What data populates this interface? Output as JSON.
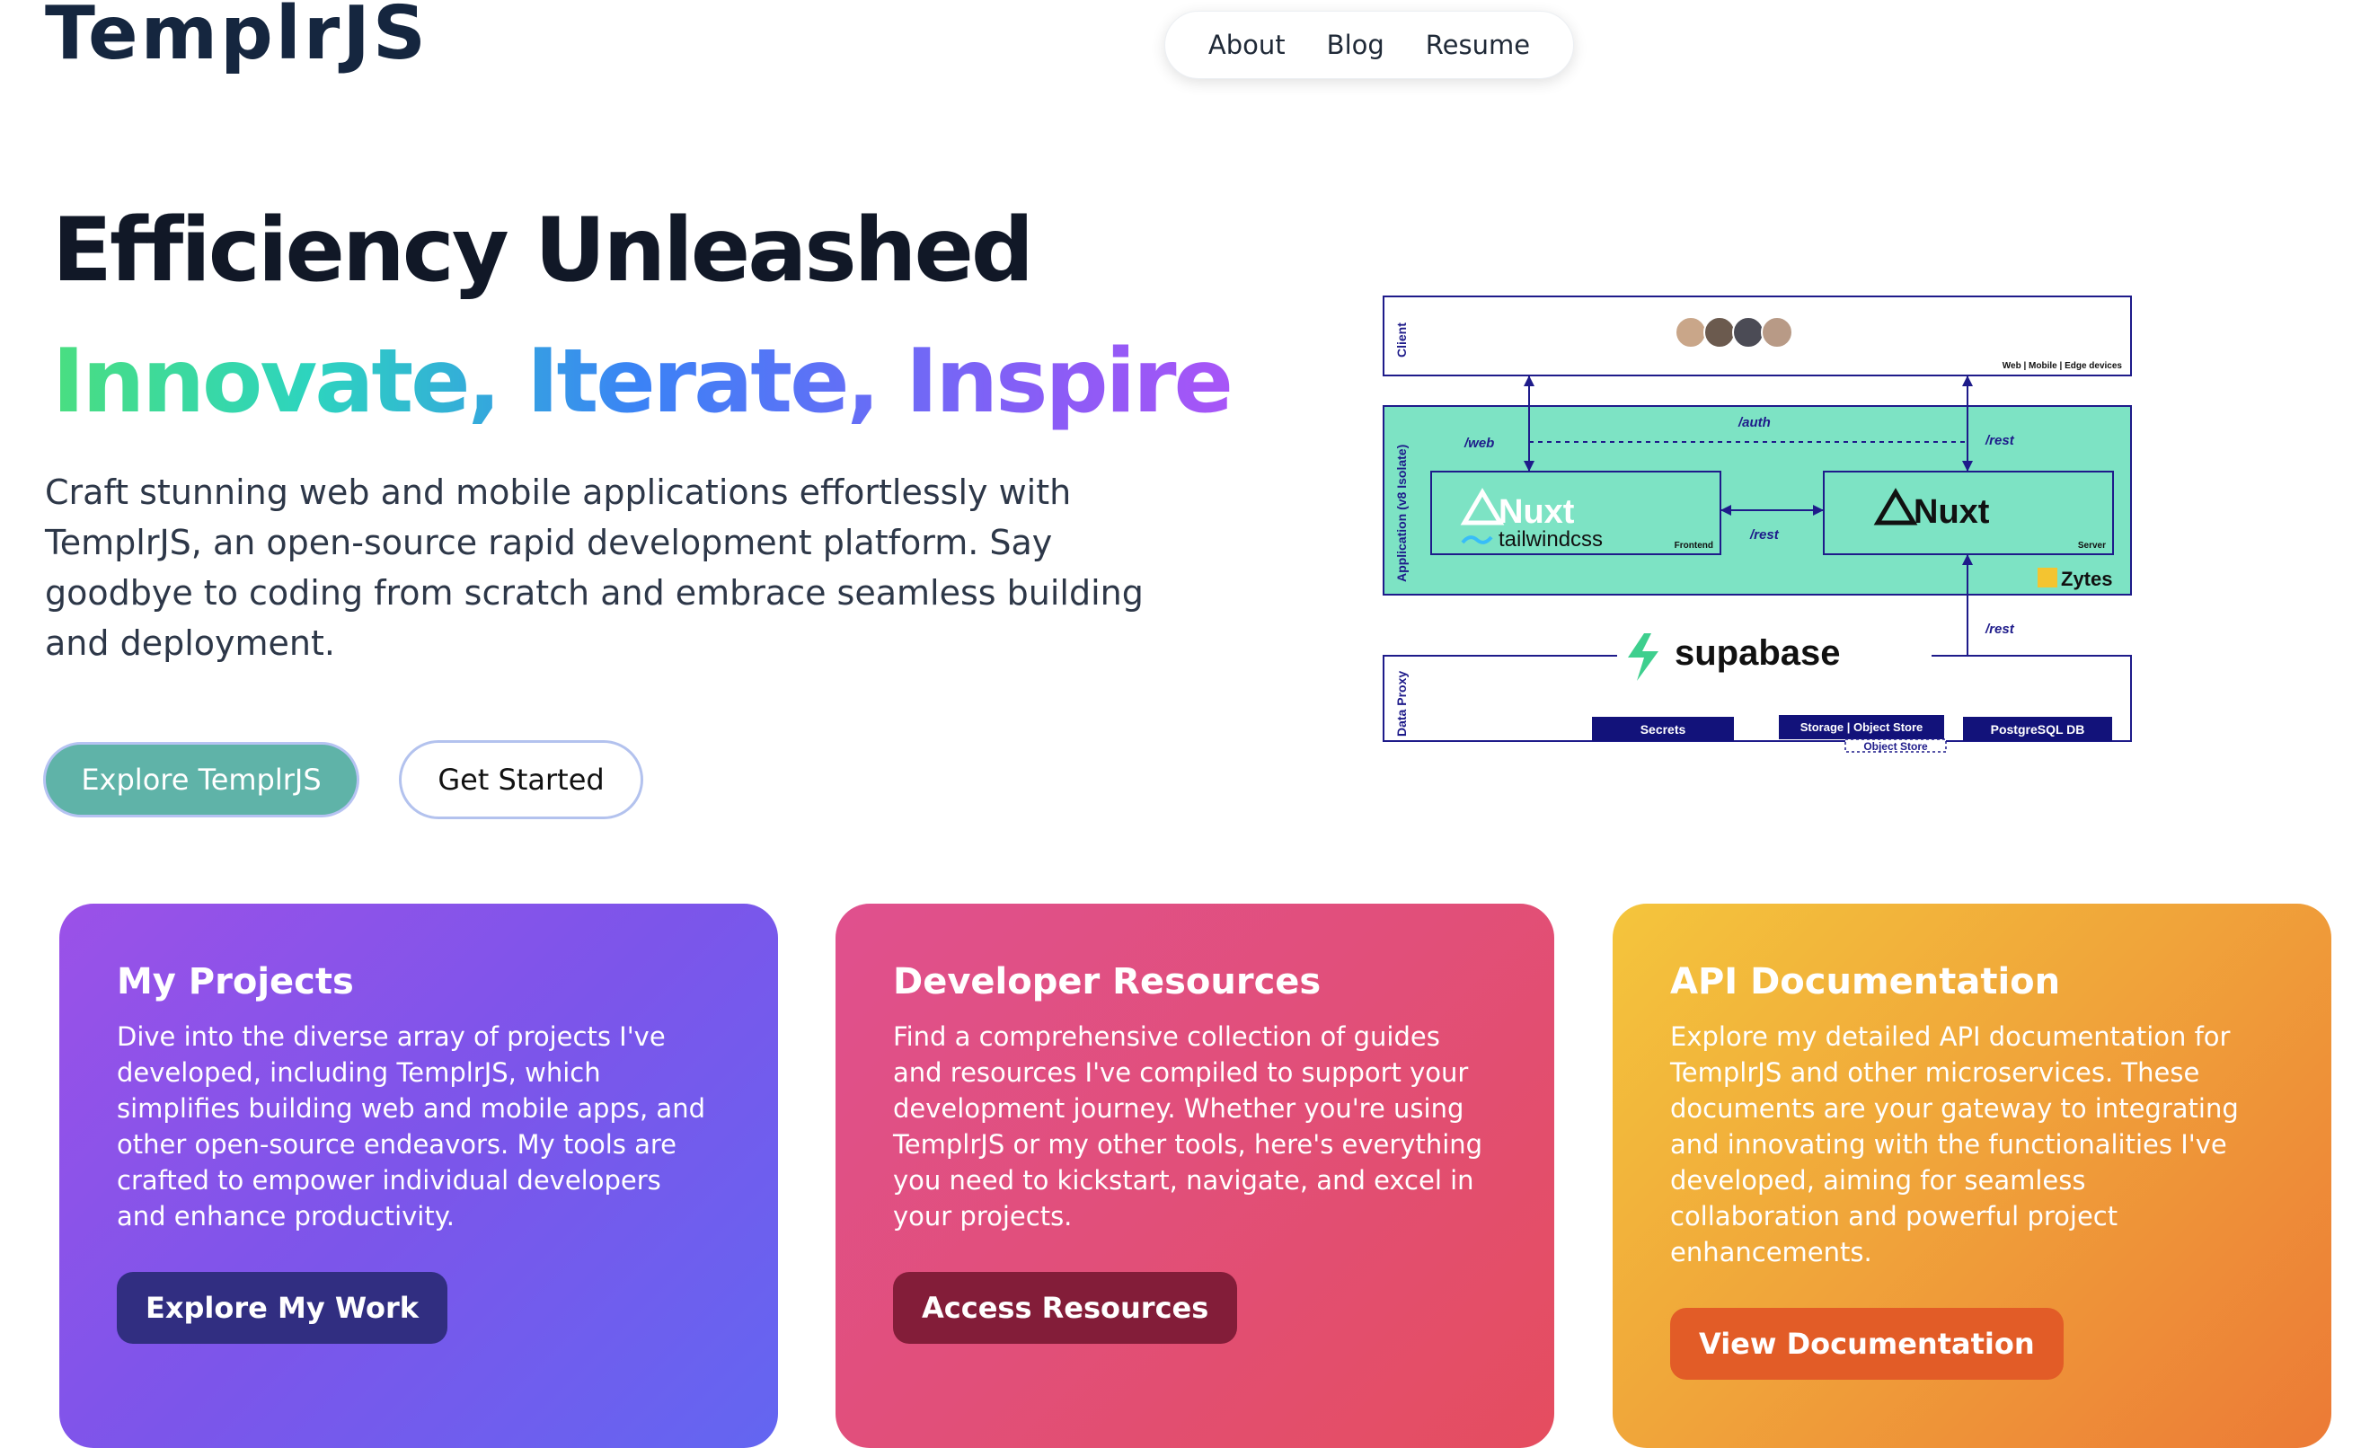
{
  "header": {
    "logo": "TemplrJS",
    "nav": [
      "About",
      "Blog",
      "Resume"
    ]
  },
  "hero": {
    "title": "Efficiency Unleashed",
    "subtitle": "Innovate, Iterate, Inspire",
    "description": "Craft stunning web and mobile applications effortlessly with TemplrJS, an open-source rapid development platform. Say goodbye to coding from scratch and embrace seamless building and deployment.",
    "primary_button": "Explore TemplrJS",
    "secondary_button": "Get Started"
  },
  "diagram": {
    "client_label": "Client",
    "devices": "Web | Mobile | Edge devices",
    "app_label": "Application (v8 Isolate)",
    "web_route": "/web",
    "auth_route": "/auth",
    "rest_route": "/rest",
    "rest_route_mid": "/rest",
    "rest_route_low": "/rest",
    "frontend_brand": "Nuxt",
    "frontend_css": "tailwindcss",
    "frontend_label": "Frontend",
    "server_brand": "Nuxt",
    "server_label": "Server",
    "zytes": "Zytes",
    "supabase": "supabase",
    "data_label": "Data Proxy",
    "secrets": "Secrets",
    "storage": "Storage | Object Store",
    "object_store": "Object Store",
    "postgres": "PostgreSQL DB"
  },
  "cards": [
    {
      "title": "My Projects",
      "body": "Dive into the diverse array of projects I've developed, including TemplrJS, which simplifies building web and mobile apps, and other open-source endeavors. My tools are crafted to empower individual developers and enhance productivity.",
      "button": "Explore My Work"
    },
    {
      "title": "Developer Resources",
      "body": "Find a comprehensive collection of guides and resources I've compiled to support your development journey. Whether you're using TemplrJS or my other tools, here's everything you need to kickstart, navigate, and excel in your projects.",
      "button": "Access Resources"
    },
    {
      "title": "API Documentation",
      "body": "Explore my detailed API documentation for TemplrJS and other microservices. These documents are your gateway to integrating and innovating with the functionalities I've developed, aiming for seamless collaboration and powerful project enhancements.",
      "button": "View Documentation"
    }
  ]
}
